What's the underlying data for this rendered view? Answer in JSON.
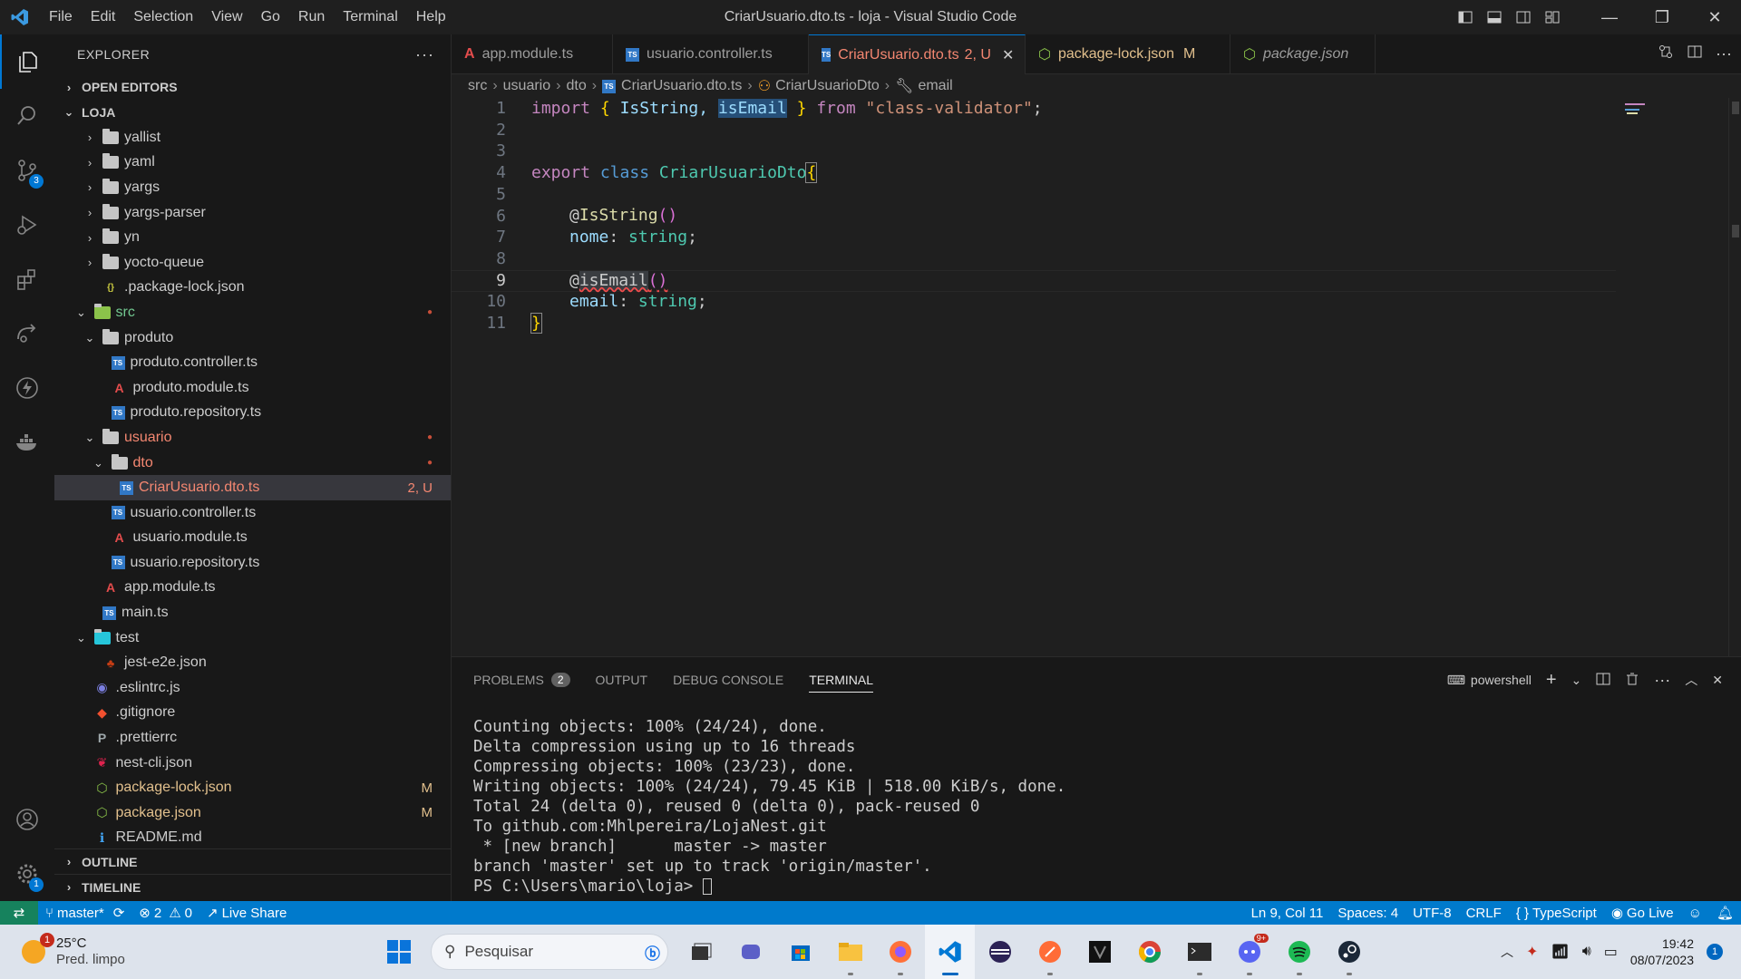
{
  "window": {
    "title": "CriarUsuario.dto.ts - loja - Visual Studio Code",
    "menu": [
      "File",
      "Edit",
      "Selection",
      "View",
      "Go",
      "Run",
      "Terminal",
      "Help"
    ]
  },
  "activity": {
    "source_control_badge": "3",
    "settings_badge": "1"
  },
  "sidebar": {
    "header": "EXPLORER",
    "open_editors": "OPEN EDITORS",
    "root": "LOJA",
    "outline": "OUTLINE",
    "timeline": "TIMELINE",
    "items": [
      {
        "label": "yallist",
        "kind": "folder",
        "depth": 2,
        "chev": "›"
      },
      {
        "label": "yaml",
        "kind": "folder",
        "depth": 2,
        "chev": "›"
      },
      {
        "label": "yargs",
        "kind": "folder",
        "depth": 2,
        "chev": "›"
      },
      {
        "label": "yargs-parser",
        "kind": "folder",
        "depth": 2,
        "chev": "›"
      },
      {
        "label": "yn",
        "kind": "folder",
        "depth": 2,
        "chev": "›"
      },
      {
        "label": "yocto-queue",
        "kind": "folder",
        "depth": 2,
        "chev": "›"
      },
      {
        "label": ".package-lock.json",
        "kind": "json",
        "depth": 2
      },
      {
        "label": "src",
        "kind": "src",
        "depth": 1,
        "chev": "⌄",
        "color": "#73c991",
        "deco": "●"
      },
      {
        "label": "produto",
        "kind": "folder",
        "depth": 2,
        "chev": "⌄"
      },
      {
        "label": "produto.controller.ts",
        "kind": "ts",
        "depth": 3
      },
      {
        "label": "produto.module.ts",
        "kind": "ng",
        "depth": 3
      },
      {
        "label": "produto.repository.ts",
        "kind": "ts",
        "depth": 3
      },
      {
        "label": "usuario",
        "kind": "folder",
        "depth": 2,
        "chev": "⌄",
        "color": "#f48771",
        "deco": "●"
      },
      {
        "label": "dto",
        "kind": "folder",
        "depth": 3,
        "chev": "⌄",
        "color": "#f48771",
        "deco": "●"
      },
      {
        "label": "CriarUsuario.dto.ts",
        "kind": "ts",
        "depth": 4,
        "color": "#f48771",
        "deco": "2, U",
        "selected": true
      },
      {
        "label": "usuario.controller.ts",
        "kind": "ts",
        "depth": 3
      },
      {
        "label": "usuario.module.ts",
        "kind": "ng",
        "depth": 3
      },
      {
        "label": "usuario.repository.ts",
        "kind": "ts",
        "depth": 3
      },
      {
        "label": "app.module.ts",
        "kind": "ng",
        "depth": 2
      },
      {
        "label": "main.ts",
        "kind": "ts",
        "depth": 2
      },
      {
        "label": "test",
        "kind": "test",
        "depth": 1,
        "chev": "⌄"
      },
      {
        "label": "jest-e2e.json",
        "kind": "jest",
        "depth": 2
      },
      {
        "label": ".eslintrc.js",
        "kind": "eslint",
        "depth": 1
      },
      {
        "label": ".gitignore",
        "kind": "git",
        "depth": 1
      },
      {
        "label": ".prettierrc",
        "kind": "prettier",
        "depth": 1
      },
      {
        "label": "nest-cli.json",
        "kind": "nest",
        "depth": 1
      },
      {
        "label": "package-lock.json",
        "kind": "npm",
        "depth": 1,
        "color": "#e2c08d",
        "deco": "M"
      },
      {
        "label": "package.json",
        "kind": "npm",
        "depth": 1,
        "color": "#e2c08d",
        "deco": "M"
      },
      {
        "label": "README.md",
        "kind": "info",
        "depth": 1
      }
    ]
  },
  "tabs": [
    {
      "label": "app.module.ts",
      "kind": "ng"
    },
    {
      "label": "usuario.controller.ts",
      "kind": "ts"
    },
    {
      "label": "CriarUsuario.dto.ts",
      "suffix": "2, U",
      "kind": "ts",
      "active": true
    },
    {
      "label": "package-lock.json",
      "suffix": "M",
      "kind": "npm"
    },
    {
      "label": "package.json",
      "kind": "npm",
      "italic": true
    }
  ],
  "breadcrumb": [
    "src",
    "usuario",
    "dto",
    "CriarUsuario.dto.ts",
    "CriarUsuarioDto",
    "email"
  ],
  "editor": {
    "line_numbers": [
      "1",
      "2",
      "3",
      "4",
      "5",
      "6",
      "7",
      "8",
      "9",
      "10",
      "11"
    ],
    "lines": {
      "l1": {
        "kw": "import",
        "b1": "{",
        "a": "IsString,",
        "b": "isEmail",
        "b2": "}",
        "from": "from",
        "str": "\"class-validator\"",
        "semi": ";"
      },
      "l4": {
        "export": "export",
        "class": "class",
        "name": "CriarUsuarioDto",
        "brace": "{"
      },
      "l6": {
        "at": "@",
        "fn": "IsString",
        "parens": "()"
      },
      "l7": {
        "prop": "nome",
        "colon": ":",
        "type": "string",
        "semi": ";"
      },
      "l9": {
        "at": "@",
        "fn": "isEmail",
        "parens": "()"
      },
      "l10": {
        "prop": "email",
        "colon": ":",
        "type": "string",
        "semi": ";"
      },
      "l11": {
        "brace": "}"
      }
    }
  },
  "panel": {
    "tabs": [
      "PROBLEMS",
      "OUTPUT",
      "DEBUG CONSOLE",
      "TERMINAL"
    ],
    "problems_count": "2",
    "shell": "powershell",
    "terminal_lines": [
      "Counting objects: 100% (24/24), done.",
      "Delta compression using up to 16 threads",
      "Compressing objects: 100% (23/23), done.",
      "Writing objects: 100% (24/24), 79.45 KiB | 518.00 KiB/s, done.",
      "Total 24 (delta 0), reused 0 (delta 0), pack-reused 0",
      "To github.com:Mhlpereira/LojaNest.git",
      " * [new branch]      master -> master",
      "branch 'master' set up to track 'origin/master'."
    ],
    "prompt": "PS C:\\Users\\mario\\loja> "
  },
  "status": {
    "branch": "master*",
    "errors": "2",
    "warnings": "0",
    "live_share": "Live Share",
    "position": "Ln 9, Col 11",
    "spaces": "Spaces: 4",
    "encoding": "UTF-8",
    "eol": "CRLF",
    "language": "TypeScript",
    "go_live": "Go Live"
  },
  "taskbar": {
    "temp": "25°C",
    "weather": "Pred. limpo",
    "weather_badge": "1",
    "search_placeholder": "Pesquisar",
    "time": "19:42",
    "date": "08/07/2023",
    "notif": "1",
    "discord_badge": "9+"
  },
  "colors": {
    "accent": "#0078d4",
    "statusbar": "#007acc",
    "modified": "#e2c08d",
    "untracked": "#f48771",
    "ts": "#3178c6"
  }
}
